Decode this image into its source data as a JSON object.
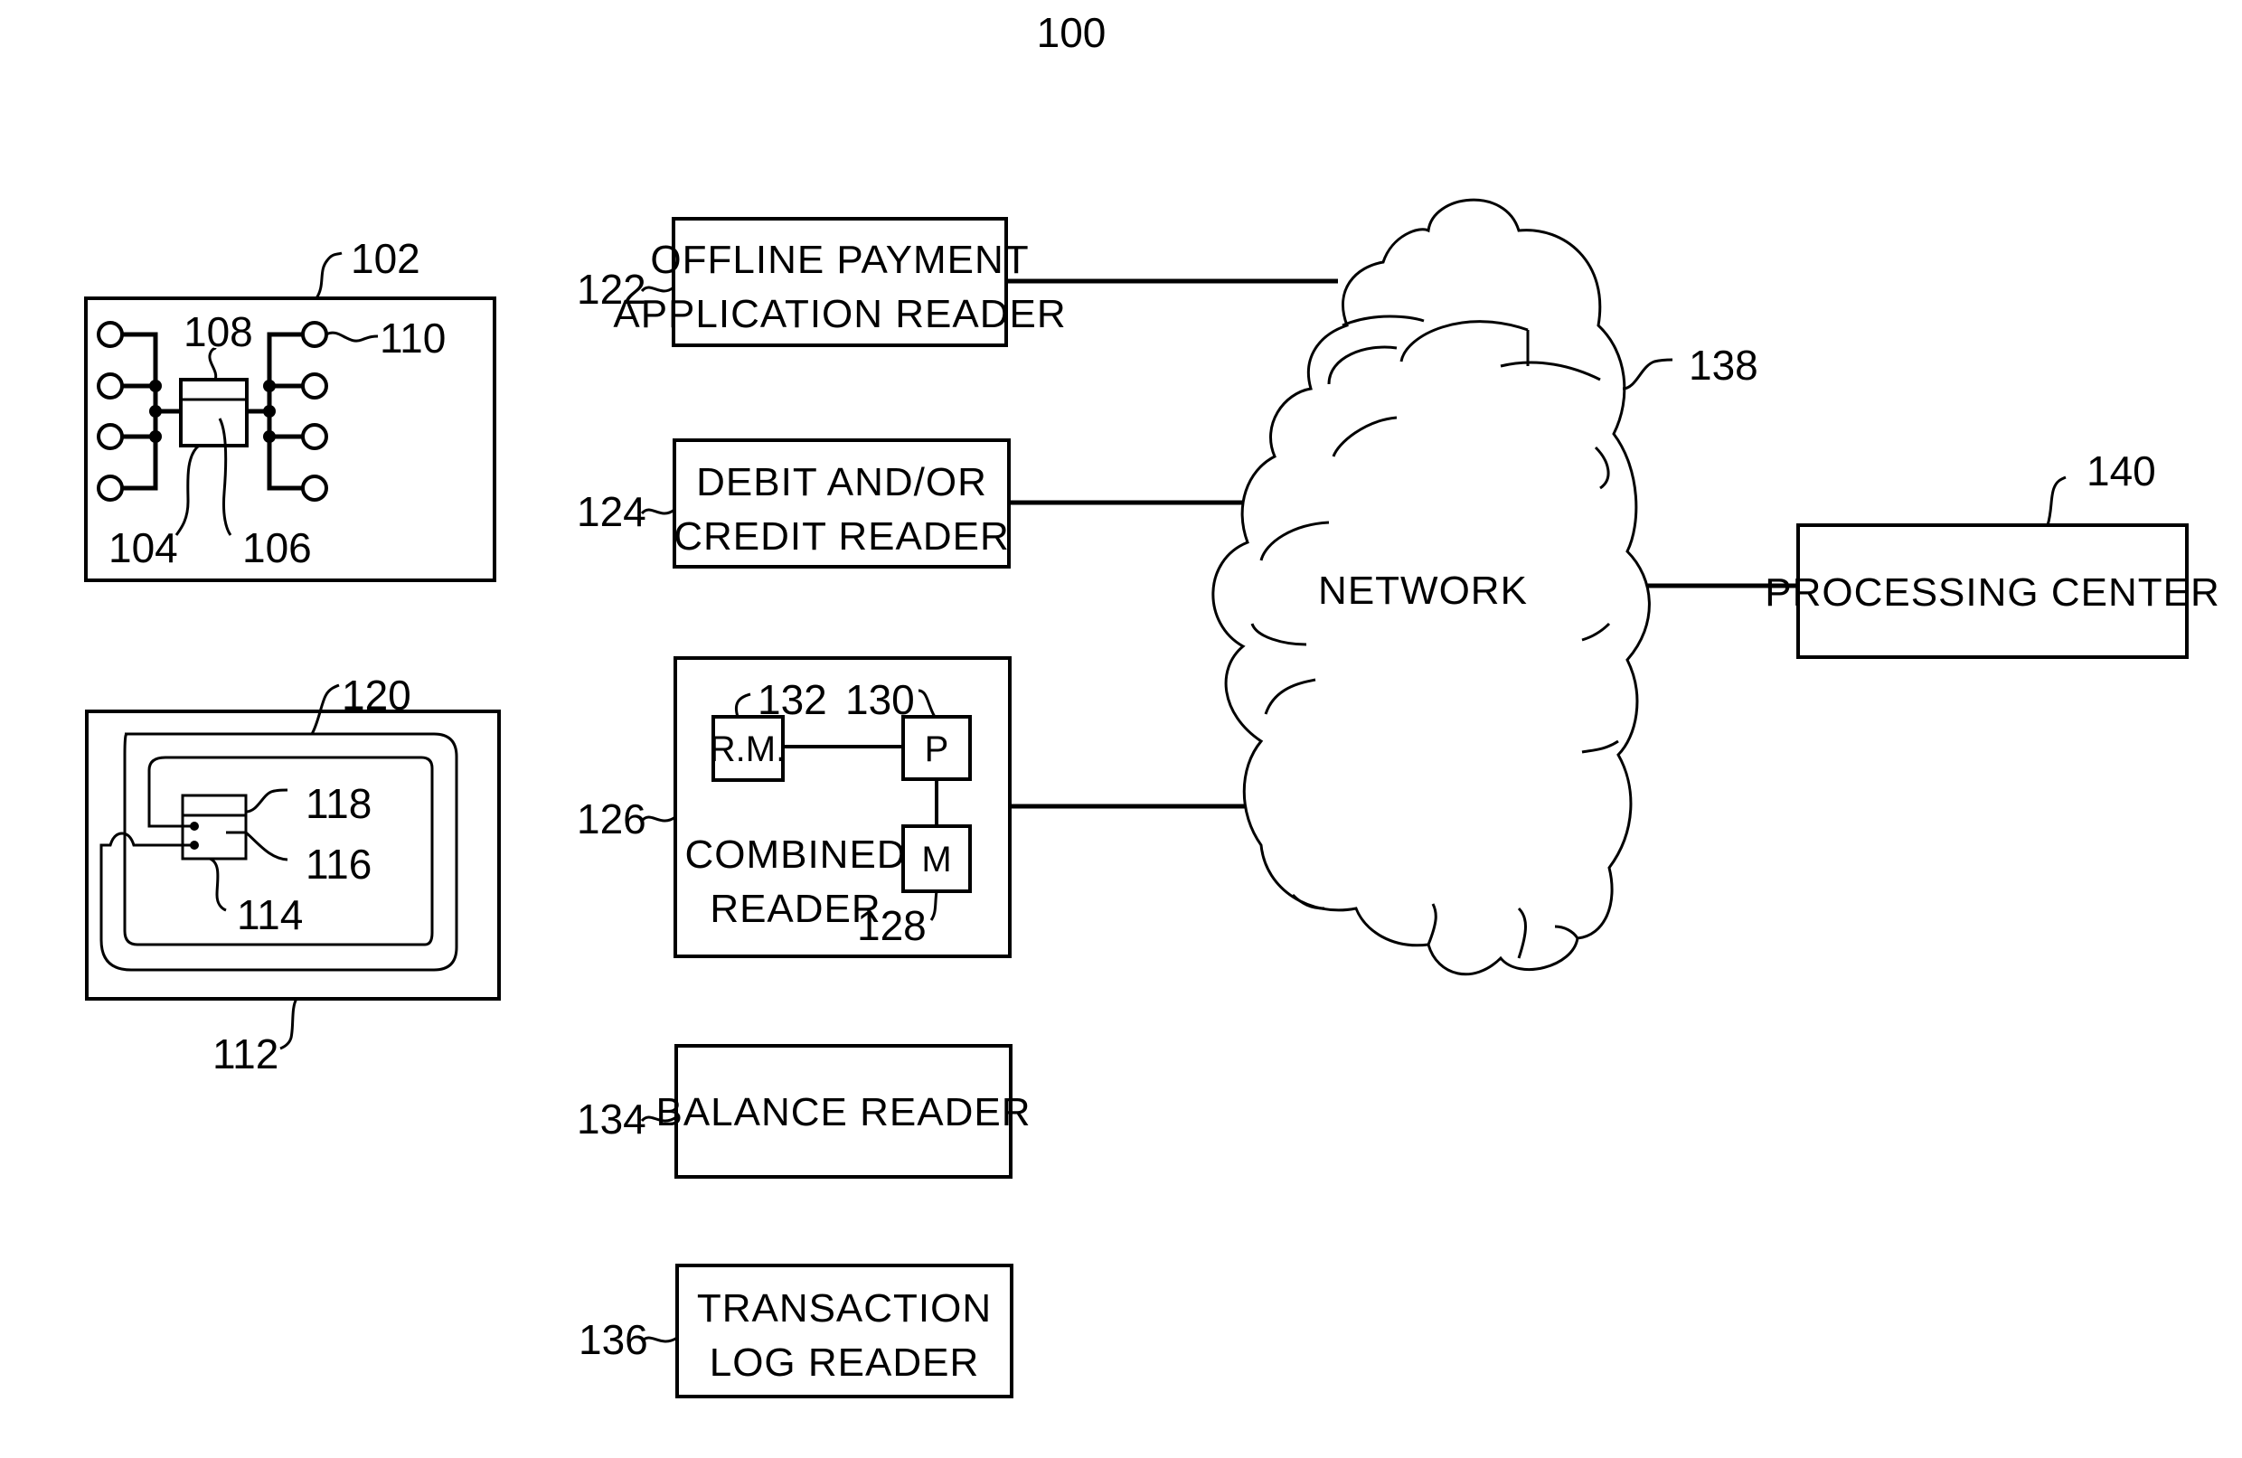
{
  "figure": {
    "number": "100",
    "contact_card": {
      "ref": "102",
      "chip_ref_1": "104",
      "chip_ref_2": "106",
      "chip_ref_3": "108",
      "contact_ref": "110"
    },
    "contactless_card": {
      "ref": "112",
      "chip_ref_1": "114",
      "chip_ref_2": "116",
      "chip_ref_3": "118",
      "antenna_ref": "120"
    },
    "readers": [
      {
        "ref": "122",
        "line1": "OFFLINE PAYMENT",
        "line2": "APPLICATION READER"
      },
      {
        "ref": "124",
        "line1": "DEBIT AND/OR",
        "line2": "CREDIT READER"
      },
      {
        "ref": "126",
        "line1": "COMBINED",
        "line2": "READER",
        "modules": [
          {
            "ref": "132",
            "label": "R.M."
          },
          {
            "ref": "130",
            "label": "P"
          },
          {
            "ref": "128",
            "label": "M"
          }
        ]
      },
      {
        "ref": "134",
        "line1": "BALANCE READER"
      },
      {
        "ref": "136",
        "line1": "TRANSACTION",
        "line2": "LOG READER"
      }
    ],
    "network": {
      "ref": "138",
      "label": "NETWORK"
    },
    "processing_center": {
      "ref": "140",
      "label": "PROCESSING CENTER"
    }
  }
}
